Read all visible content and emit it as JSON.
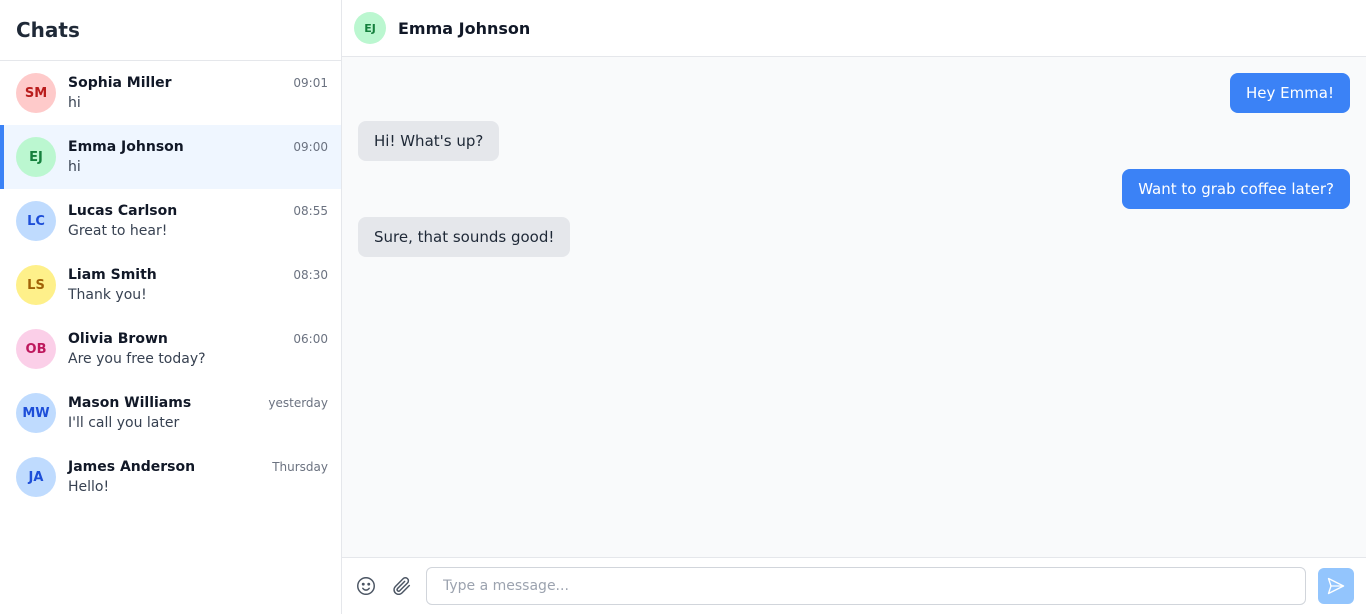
{
  "sidebar": {
    "title": "Chats",
    "chats": [
      {
        "initials": "SM",
        "name": "Sophia Miller",
        "time": "09:01",
        "preview": "hi",
        "avatar_bg": "#fecaca",
        "avatar_fg": "#b91c1c"
      },
      {
        "initials": "EJ",
        "name": "Emma Johnson",
        "time": "09:00",
        "preview": "hi",
        "avatar_bg": "#bbf7d0",
        "avatar_fg": "#15803d"
      },
      {
        "initials": "LC",
        "name": "Lucas Carlson",
        "time": "08:55",
        "preview": "Great to hear!",
        "avatar_bg": "#bfdbfe",
        "avatar_fg": "#1d4ed8"
      },
      {
        "initials": "LS",
        "name": "Liam Smith",
        "time": "08:30",
        "preview": "Thank you!",
        "avatar_bg": "#fef08a",
        "avatar_fg": "#a16207"
      },
      {
        "initials": "OB",
        "name": "Olivia Brown",
        "time": "06:00",
        "preview": "Are you free today?",
        "avatar_bg": "#fbcfe8",
        "avatar_fg": "#be185d"
      },
      {
        "initials": "MW",
        "name": "Mason Williams",
        "time": "yesterday",
        "preview": "I'll call you later",
        "avatar_bg": "#bfdbfe",
        "avatar_fg": "#1d4ed8"
      },
      {
        "initials": "JA",
        "name": "James Anderson",
        "time": "Thursday",
        "preview": "Hello!",
        "avatar_bg": "#bfdbfe",
        "avatar_fg": "#1d4ed8"
      }
    ],
    "active_index": 1
  },
  "conversation": {
    "contact_initials": "EJ",
    "contact_name": "Emma Johnson",
    "avatar_bg": "#bbf7d0",
    "avatar_fg": "#15803d",
    "messages": [
      {
        "direction": "out",
        "text": "Hey Emma!"
      },
      {
        "direction": "in",
        "text": "Hi! What's up?"
      },
      {
        "direction": "out",
        "text": "Want to grab coffee later?"
      },
      {
        "direction": "in",
        "text": "Sure, that sounds good!"
      }
    ]
  },
  "composer": {
    "placeholder": "Type a message...",
    "value": "",
    "emoji_icon": "smiley-face-icon",
    "attach_icon": "paperclip-icon",
    "send_icon": "paper-plane-send-icon"
  },
  "colors": {
    "accent": "#3b82f6",
    "send_button_disabled": "#93c5fd",
    "active_chat_bg": "#eff6ff",
    "incoming_bubble": "#e5e7eb"
  }
}
